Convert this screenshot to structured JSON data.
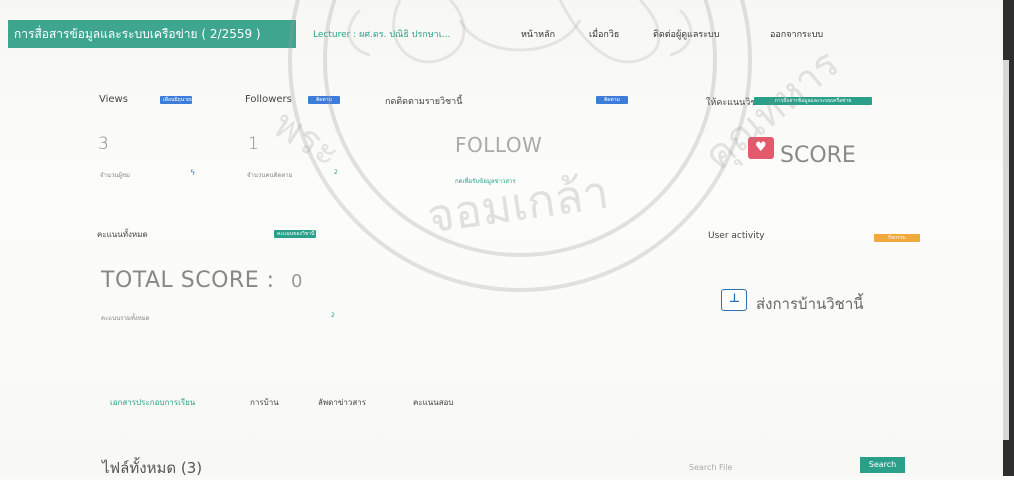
{
  "app": {
    "brand": "การสื่อสารข้อมูลและระบบเครือข่าย ( 2/2559 )",
    "lecturer": "Lecturer : ผศ.ดร. ปณิธิ ปรกษาเ...",
    "nav": [
      "หน้าหลัก",
      "เมื่อกวิธ",
      "ติดต่อผู้ดูแลระบบ",
      "ออกจากระบบ"
    ]
  },
  "stats": {
    "views": {
      "label": "Views",
      "badge": "เดือนมิถุนายน",
      "value": "3",
      "note": "จำนวนผู้ชม",
      "icon": "flash-icon"
    },
    "followers": {
      "label": "Followers",
      "badge": "ติดตาม",
      "value": "1",
      "note": "จำนวนคนติดตาม",
      "trend": "2"
    },
    "follow": {
      "label": "กดติดตามรายวิชานี้",
      "badge": "ติดตาม",
      "big": "FOLLOW",
      "note": "กดเพื่อรับข้อมูลข่าวสาร"
    },
    "score": {
      "label": "ให้คะแนนวิชา",
      "badge": "การสื่อสารข้อมูลและระบบเครือข่าย",
      "big": "SCORE"
    }
  },
  "total": {
    "label": "คะแนนทั้งหมด",
    "badge": "คะแนนของวิชานี้",
    "title": "TOTAL SCORE :",
    "value": "0",
    "note": "คะแนนรวมทั้งหมด",
    "trend": "2"
  },
  "activity": {
    "label": "User activity",
    "badge": "กิจกรรม",
    "action": "ส่งการบ้านวิชานี้"
  },
  "tabs": [
    "เอกสารประกอบการเรียน",
    "การบ้าน",
    "ลัพดาข่าวสาร",
    "คะแนนสอบ"
  ],
  "files": {
    "title": "ไฟล์ทั้งหมด",
    "count": "(3)",
    "search_placeholder": "Search File",
    "search_button": "Search"
  },
  "colors": {
    "accent": "#3ea68f",
    "teal": "#2aa08b",
    "blue": "#3b7dd8",
    "pink": "#e45a6d",
    "orange": "#f0a93a"
  }
}
